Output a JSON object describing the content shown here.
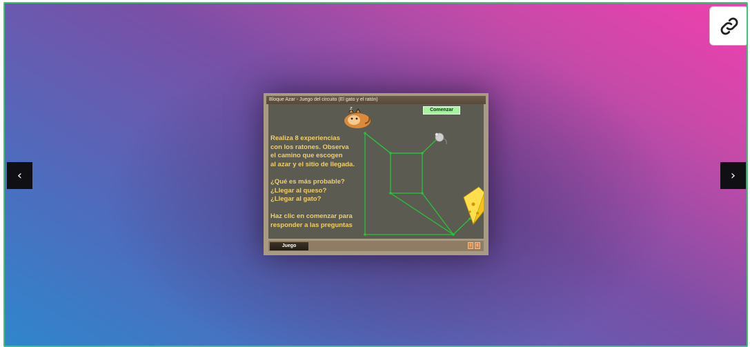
{
  "carousel": {
    "prev_label": "‹",
    "next_label": "›"
  },
  "link_button": {
    "icon": "link-icon"
  },
  "applet": {
    "title": "Bloque Azar - Juego del circuito (El gato y el ratón)",
    "start_button": "Comenzar",
    "instructions": [
      "Realiza 8 experiencias",
      "con los ratones. Observa",
      "el camino que escogen",
      "al azar y el sitio de llegada.",
      "",
      "¿Qué es más probable?",
      "¿Llegar al queso?",
      "¿Llegar al gato?",
      "",
      "Haz clic en comenzar para",
      "responder a las preguntas"
    ],
    "tab_label": "Juego",
    "mini_buttons": [
      "i",
      "c"
    ]
  },
  "colors": {
    "border": "#3ec47a",
    "gradient_start": "#2f86cc",
    "gradient_end": "#f13fae",
    "path": "#27c43a",
    "instruction_text": "#f1cf6a",
    "canvas": "#5b5b52"
  }
}
